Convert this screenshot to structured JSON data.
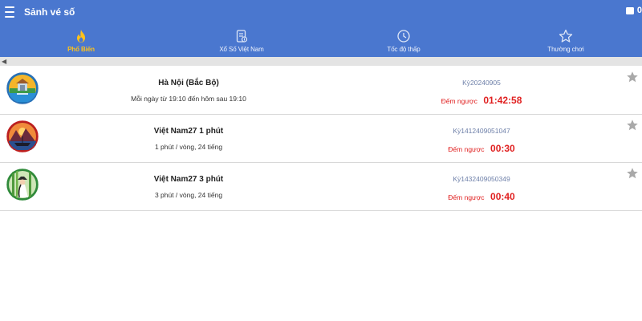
{
  "header": {
    "title": "Sảnh vé số",
    "balance": "0"
  },
  "tabs": [
    {
      "label": "Phổ Biến",
      "icon": "fire-icon",
      "active": true
    },
    {
      "label": "Xổ Số Việt Nam",
      "icon": "ticket-icon",
      "active": false
    },
    {
      "label": "Tốc độ thấp",
      "icon": "clock-icon",
      "active": false
    },
    {
      "label": "Thường chơi",
      "icon": "star-outline-icon",
      "active": false
    }
  ],
  "games": [
    {
      "name": "Hà Nội (Bắc Bộ)",
      "schedule": "Mỗi ngày từ 19:10 đến hôm sau 19:10",
      "period": "Kỳ20240905",
      "countdown_label": "Đếm ngược",
      "countdown": "01:42:58",
      "avatar": "hanoi-temple"
    },
    {
      "name": "Việt Nam27 1 phút",
      "schedule": "1 phút / vòng, 24 tiếng",
      "period": "Kỳ1412409051047",
      "countdown_label": "Đếm ngược",
      "countdown": "00:30",
      "avatar": "boat-sunset"
    },
    {
      "name": "Việt Nam27 3 phút",
      "schedule": "3 phút / vòng, 24 tiếng",
      "period": "Kỳ1432409050349",
      "countdown_label": "Đếm ngược",
      "countdown": "00:40",
      "avatar": "bamboo-lady"
    }
  ],
  "colors": {
    "header_bg": "#4a77cf",
    "active_tab": "#ffc21a",
    "countdown": "#e02020",
    "period": "#6d7fa8"
  }
}
